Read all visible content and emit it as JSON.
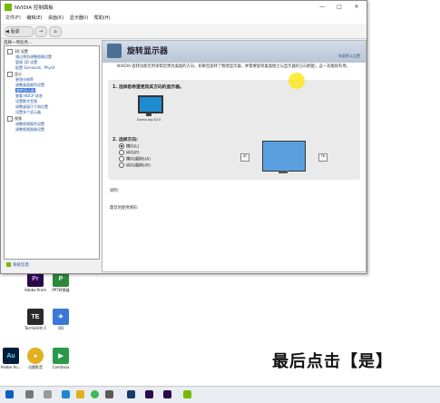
{
  "window": {
    "title": "NVIDIA 控制面板",
    "menu": [
      "文件(F)",
      "编辑(E)",
      "桌面(K)",
      "显示器(I)",
      "帮助(H)"
    ],
    "toolbar": {
      "back": "后退",
      "forward": "→"
    },
    "controls": {
      "minimize": "—",
      "maximize": "□",
      "close": "✕"
    }
  },
  "tree": {
    "label": "选择一项任务...",
    "items": [
      {
        "text": "3D 设置",
        "kind": "cat"
      },
      {
        "text": "通过预览调整图像设置",
        "kind": "leaf"
      },
      {
        "text": "管理 3D 设置",
        "kind": "leaf"
      },
      {
        "text": "配置 Surround、PhysX",
        "kind": "leaf"
      },
      {
        "text": "显示",
        "kind": "cat"
      },
      {
        "text": "更改分辨率",
        "kind": "leaf"
      },
      {
        "text": "调整桌面颜色设置",
        "kind": "leaf"
      },
      {
        "text": "旋转显示器",
        "kind": "sel"
      },
      {
        "text": "查看 HDCP 状态",
        "kind": "leaf"
      },
      {
        "text": "设置数字音频",
        "kind": "leaf"
      },
      {
        "text": "调整桌面尺寸和位置",
        "kind": "leaf"
      },
      {
        "text": "设置多个显示器",
        "kind": "leaf"
      },
      {
        "text": "视频",
        "kind": "cat"
      },
      {
        "text": "调整视频颜色设置",
        "kind": "leaf"
      },
      {
        "text": "调整视频图像设置",
        "kind": "leaf"
      }
    ],
    "system_info": "系统信息"
  },
  "page": {
    "title": "旋转显示器",
    "restore_link": "恢复默认设置",
    "description": "NVIDIA 旋转功能可用来帮您更改桌面的方向，如果您旋转了物理显示器，并需要旋转桌面使之与显示器的方向相配，这一功能很有用。",
    "step1": "1. 选择您希望更改其方向的显示器。",
    "monitor_label": "Samsung S24",
    "step2": "2. 选择方向:",
    "orientations": [
      {
        "label": "横向(L)",
        "selected": true
      },
      {
        "label": "纵向(P)",
        "selected": false
      },
      {
        "label": "横向(翻转)(A)",
        "selected": false
      },
      {
        "label": "纵向(翻转)(R)",
        "selected": false
      }
    ],
    "desc_label": "说明:",
    "usage_label": "典型的使用情形:"
  },
  "desktop_icons": [
    {
      "label": "Adobe Premiere P...",
      "color": "#2a0a4a",
      "glyph": "Pr"
    },
    {
      "label": "PPT转换器",
      "color": "#2a8a3a",
      "glyph": "P"
    },
    {
      "label": "TechSmith Ca...",
      "color": "#2a2a2a",
      "glyph": "TE"
    },
    {
      "label": "QQ",
      "color": "#3a78d8",
      "glyph": "✈"
    },
    {
      "label": "Adobe Au...",
      "color": "#00203a",
      "glyph": "Au"
    },
    {
      "label": "迅雷影音",
      "color": "#e0b020",
      "glyph": "●"
    },
    {
      "label": "Camtasia",
      "color": "#2a9a4a",
      "glyph": "▶"
    }
  ],
  "caption": "最后点击【是】"
}
